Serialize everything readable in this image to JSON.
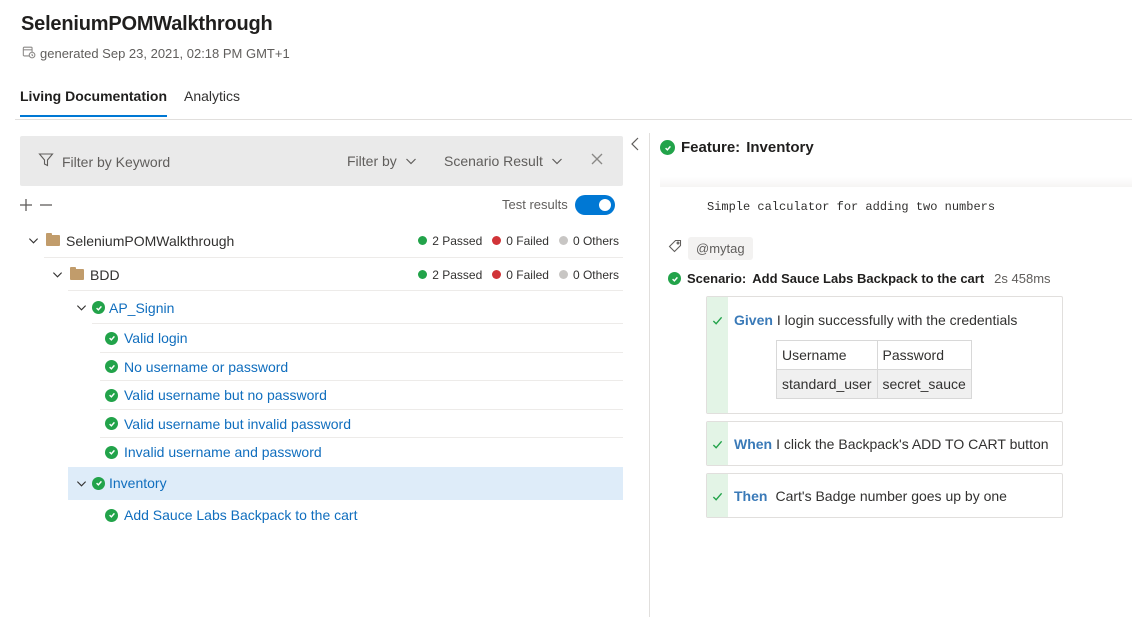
{
  "header": {
    "title": "SeleniumPOMWalkthrough",
    "generated": "generated Sep 23, 2021, 02:18 PM GMT+1"
  },
  "tabs": [
    {
      "label": "Living Documentation",
      "active": true
    },
    {
      "label": "Analytics",
      "active": false
    }
  ],
  "filter": {
    "keyword_placeholder": "Filter by Keyword",
    "filter_by_label": "Filter by",
    "scenario_result_label": "Scenario Result"
  },
  "tree_controls": {
    "test_results_label": "Test results",
    "test_results_on": true
  },
  "tree": {
    "root": {
      "label": "SeleniumPOMWalkthrough",
      "passed": "2 Passed",
      "failed": "0 Failed",
      "others": "0 Others"
    },
    "bdd": {
      "label": "BDD",
      "passed": "2 Passed",
      "failed": "0 Failed",
      "others": "0 Others"
    },
    "ap_signin": {
      "label": "AP_Signin",
      "scenarios": [
        "Valid login",
        "No username or password",
        "Valid username but no password",
        "Valid username but invalid password",
        "Invalid username and password"
      ]
    },
    "inventory": {
      "label": "Inventory",
      "scenarios": [
        "Add Sauce Labs Backpack to the cart"
      ]
    }
  },
  "feature": {
    "prefix": "Feature:",
    "name": "Inventory",
    "description": "Simple calculator for adding two numbers",
    "tag": "@mytag",
    "scenario": {
      "prefix": "Scenario:",
      "name": "Add Sauce Labs Backpack to the cart",
      "duration": "2s 458ms",
      "steps": [
        {
          "keyword": "Given",
          "text": "I login successfully with the credentials"
        },
        {
          "keyword": "When",
          "text": "I click the Backpack's ADD TO CART button"
        },
        {
          "keyword": "Then",
          "text": "Cart's Badge number goes up by one"
        }
      ],
      "table": {
        "headers": [
          "Username",
          "Password"
        ],
        "row": [
          "standard_user",
          "secret_sauce"
        ]
      }
    }
  },
  "colors": {
    "passed": "#22a34a",
    "failed": "#d13438",
    "others": "#c8c6c4",
    "accent": "#0078d4",
    "selected_row": "#deecf9"
  }
}
